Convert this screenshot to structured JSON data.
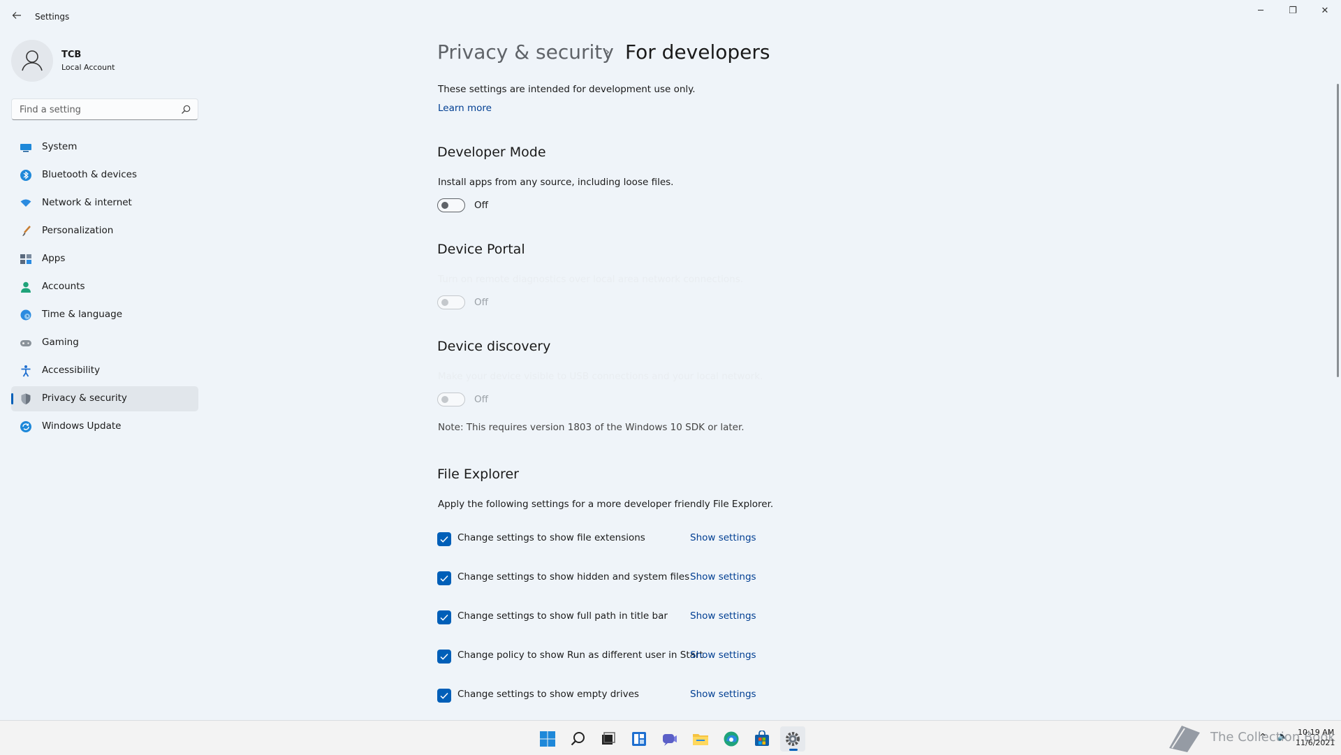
{
  "window": {
    "title": "Settings",
    "controls": {
      "minimize": "─",
      "maximize": "❐",
      "close": "✕"
    }
  },
  "account": {
    "name": "TCB",
    "type": "Local Account"
  },
  "search": {
    "placeholder": "Find a setting",
    "value": ""
  },
  "sidebar": {
    "items": [
      {
        "label": "System",
        "icon": "monitor-icon",
        "selected": false
      },
      {
        "label": "Bluetooth & devices",
        "icon": "bluetooth-icon",
        "selected": false
      },
      {
        "label": "Network & internet",
        "icon": "wifi-icon",
        "selected": false
      },
      {
        "label": "Personalization",
        "icon": "brush-icon",
        "selected": false
      },
      {
        "label": "Apps",
        "icon": "apps-icon",
        "selected": false
      },
      {
        "label": "Accounts",
        "icon": "person-icon",
        "selected": false
      },
      {
        "label": "Time & language",
        "icon": "globe-clock-icon",
        "selected": false
      },
      {
        "label": "Gaming",
        "icon": "gamepad-icon",
        "selected": false
      },
      {
        "label": "Accessibility",
        "icon": "accessibility-icon",
        "selected": false
      },
      {
        "label": "Privacy & security",
        "icon": "shield-icon",
        "selected": true
      },
      {
        "label": "Windows Update",
        "icon": "update-icon",
        "selected": false
      }
    ]
  },
  "main": {
    "breadcrumb": {
      "parent": "Privacy & security",
      "separator": "›",
      "current": "For developers"
    },
    "intro": "These settings are intended for development use only.",
    "learn_more": "Learn more",
    "developer_mode": {
      "title": "Developer Mode",
      "description": "Install apps from any source, including loose files.",
      "state": "Off"
    },
    "device_portal": {
      "title": "Device Portal",
      "description": "Turn on remote diagnostics over local area network connections.",
      "state": "Off"
    },
    "device_discovery": {
      "title": "Device discovery",
      "description": "Make your device visible to USB connections and your local network.",
      "state": "Off",
      "note": "Note: This requires version 1803 of the Windows 10 SDK or later."
    },
    "file_explorer": {
      "title": "File Explorer",
      "description": "Apply the following settings for a more developer friendly File Explorer.",
      "options": [
        {
          "label": "Change settings to show file extensions",
          "checked": true,
          "link": "Show settings"
        },
        {
          "label": "Change settings to show hidden and system files",
          "checked": true,
          "link": "Show settings"
        },
        {
          "label": "Change settings to show full path in title bar",
          "checked": true,
          "link": "Show settings"
        },
        {
          "label": "Change policy to show Run as different user in Start",
          "checked": true,
          "link": "Show settings"
        },
        {
          "label": "Change settings to show empty drives",
          "checked": true,
          "link": "Show settings"
        }
      ]
    }
  },
  "taskbar": {
    "apps": [
      "start-icon",
      "search-icon",
      "task-view-icon",
      "widgets-icon",
      "chat-icon",
      "file-explorer-icon",
      "edge-icon",
      "store-icon",
      "settings-icon"
    ],
    "watermark": "The Collection Book",
    "time": "10:19 AM",
    "date": "11/6/2021"
  },
  "colors": {
    "accent": "#005fb8",
    "link": "#003e92",
    "background": "#eff4f9"
  }
}
